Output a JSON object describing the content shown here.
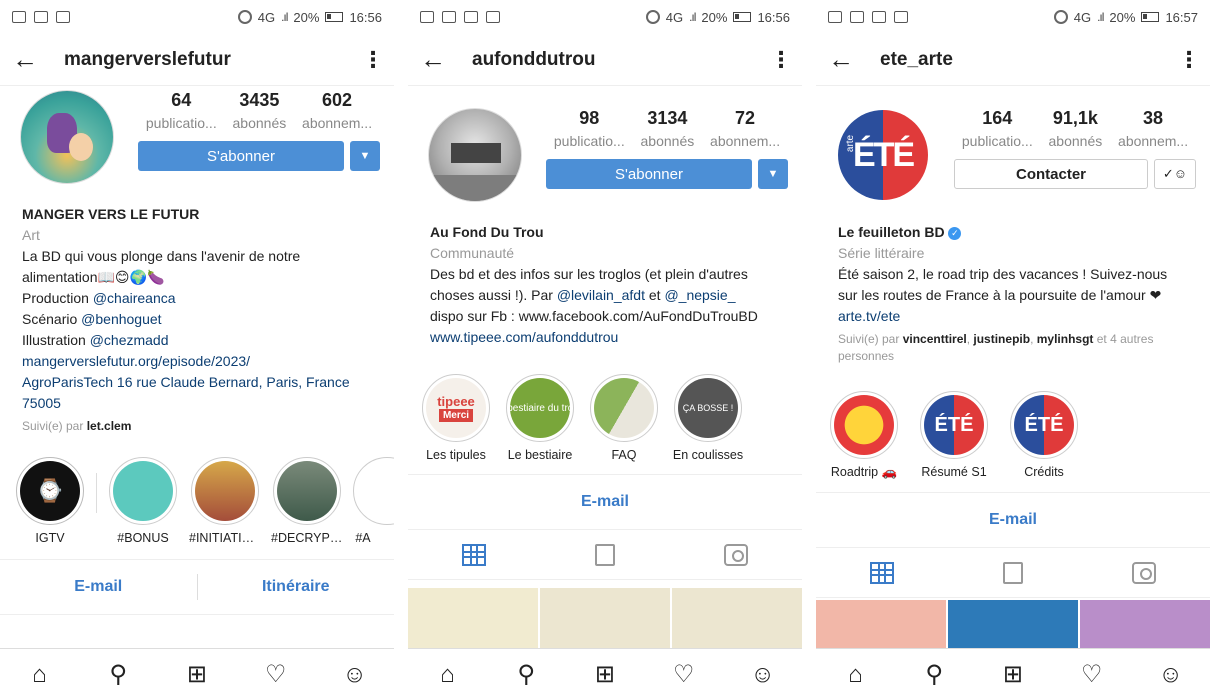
{
  "phones": [
    {
      "status": {
        "network": "4G",
        "battery": "20%",
        "time": "16:56"
      },
      "username": "mangerverslefutur",
      "stats": [
        {
          "num": "64",
          "label": "publicatio..."
        },
        {
          "num": "3435",
          "label": "abonnés"
        },
        {
          "num": "602",
          "label": "abonnem..."
        }
      ],
      "primary_button": "S'abonner",
      "name": "MANGER VERS LE FUTUR",
      "category": "Art",
      "bio": [
        "La BD qui vous plonge dans l'avenir de notre",
        "alimentation📖😊🌍🍆"
      ],
      "credits": [
        {
          "label": "Production ",
          "handle": "@chaireanca"
        },
        {
          "label": "Scénario ",
          "handle": "@benhoguet"
        },
        {
          "label": "Illustration ",
          "handle": "@chezmadd"
        }
      ],
      "website": "mangerverslefutur.org/episode/2023/",
      "address": "AgroParisTech 16 rue Claude Bernard, Paris, France 75005",
      "followed_by_prefix": "Suivi(e) par ",
      "followed_by": "let.clem",
      "highlights": [
        "IGTV",
        "#BONUS",
        "#INITIATIVES",
        "#DECRYPTA...",
        "#A"
      ],
      "actions": [
        "E-mail",
        "Itinéraire"
      ]
    },
    {
      "status": {
        "network": "4G",
        "battery": "20%",
        "time": "16:56"
      },
      "username": "aufonddutrou",
      "stats": [
        {
          "num": "98",
          "label": "publicatio..."
        },
        {
          "num": "3134",
          "label": "abonnés"
        },
        {
          "num": "72",
          "label": "abonnem..."
        }
      ],
      "primary_button": "S'abonner",
      "name": "Au Fond Du Trou",
      "category": "Communauté",
      "bio_prefix": "Des bd et des infos sur les troglos (et plein d'autres choses aussi !). Par ",
      "handle1": "@levilain_afdt",
      "bio_mid": " et ",
      "handle2": "@_nepsie_",
      "bio_line3": "dispo sur Fb : www.facebook.com/AuFondDuTrouBD",
      "website": "www.tipeee.com/aufonddutrou",
      "highlights": [
        "Les tipules",
        "Le bestiaire",
        "FAQ",
        "En coulisses"
      ],
      "highlight_texts": {
        "tipeee": "tipeee",
        "merci": "Merci",
        "bestiaire": "Le bestiaire du troglo",
        "coulisses": "ÇA BOSSE !"
      },
      "actions": [
        "E-mail"
      ]
    },
    {
      "status": {
        "network": "4G",
        "battery": "20%",
        "time": "16:57"
      },
      "username": "ete_arte",
      "stats": [
        {
          "num": "164",
          "label": "publicatio..."
        },
        {
          "num": "91,1k",
          "label": "abonnés"
        },
        {
          "num": "38",
          "label": "abonnem..."
        }
      ],
      "primary_button": "Contacter",
      "name": "Le feuilleton BD",
      "category": "Série littéraire",
      "bio": "Été saison 2, le road trip des vacances ! Suivez-nous sur les routes de France à la poursuite de l'amour ❤",
      "website": "arte.tv/ete",
      "followed_by_prefix": "Suivi(e) par ",
      "followed_by": "vincenttirel",
      "followed_by2": "justinepib",
      "followed_by3": "mylinhsgt",
      "followed_more": " et 4 autres personnes",
      "highlights": [
        "Roadtrip 🚗",
        "Résumé S1",
        "Crédits"
      ],
      "avatar_text": "ÉTÉ",
      "avatar_brand": "arte",
      "actions": [
        "E-mail"
      ]
    }
  ],
  "colors": {
    "accent": "#4c8fd6",
    "link": "#0c3e72",
    "action": "#3a7bc8"
  }
}
